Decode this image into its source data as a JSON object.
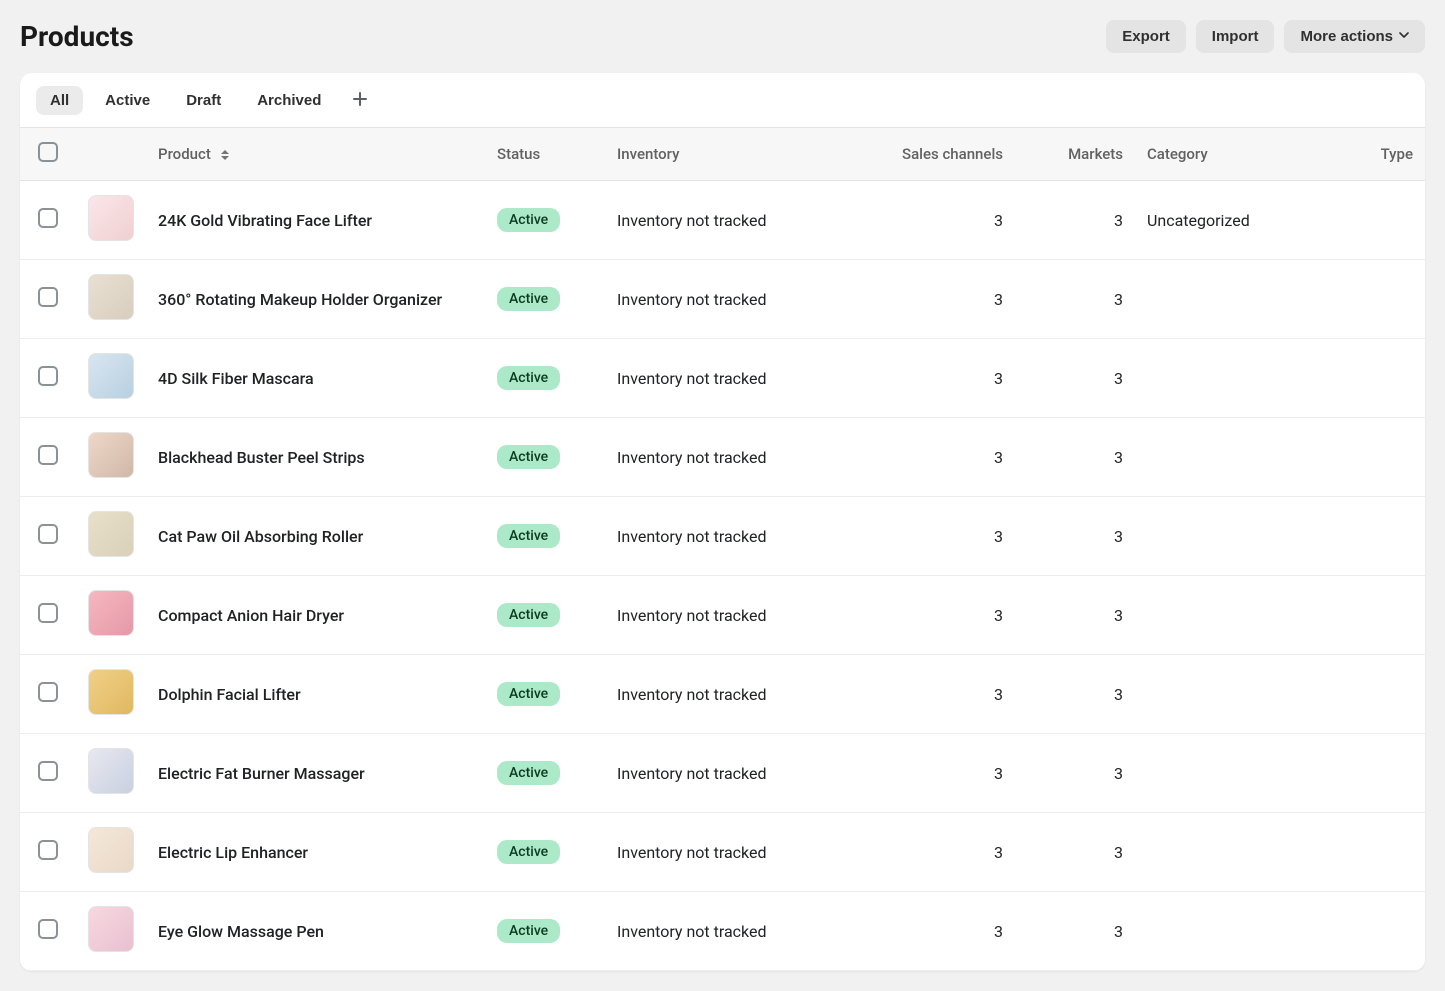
{
  "header": {
    "title": "Products",
    "export_label": "Export",
    "import_label": "Import",
    "more_label": "More actions"
  },
  "tabs": [
    "All",
    "Active",
    "Draft",
    "Archived"
  ],
  "active_tab_index": 0,
  "columns": {
    "product": "Product",
    "status": "Status",
    "inventory": "Inventory",
    "sales_channels": "Sales channels",
    "markets": "Markets",
    "category": "Category",
    "type": "Type"
  },
  "status_labels": {
    "active": "Active"
  },
  "inventory_not_tracked": "Inventory not tracked",
  "products": [
    {
      "name": "24K Gold Vibrating Face Lifter",
      "status": "active",
      "inventory": "not_tracked",
      "sales_channels": 3,
      "markets": 3,
      "category": "Uncategorized",
      "type": ""
    },
    {
      "name": "360° Rotating Makeup Holder Organizer",
      "status": "active",
      "inventory": "not_tracked",
      "sales_channels": 3,
      "markets": 3,
      "category": "",
      "type": ""
    },
    {
      "name": "4D Silk Fiber Mascara",
      "status": "active",
      "inventory": "not_tracked",
      "sales_channels": 3,
      "markets": 3,
      "category": "",
      "type": ""
    },
    {
      "name": "Blackhead Buster Peel Strips",
      "status": "active",
      "inventory": "not_tracked",
      "sales_channels": 3,
      "markets": 3,
      "category": "",
      "type": ""
    },
    {
      "name": "Cat Paw Oil Absorbing Roller",
      "status": "active",
      "inventory": "not_tracked",
      "sales_channels": 3,
      "markets": 3,
      "category": "",
      "type": ""
    },
    {
      "name": "Compact Anion Hair Dryer",
      "status": "active",
      "inventory": "not_tracked",
      "sales_channels": 3,
      "markets": 3,
      "category": "",
      "type": ""
    },
    {
      "name": "Dolphin Facial Lifter",
      "status": "active",
      "inventory": "not_tracked",
      "sales_channels": 3,
      "markets": 3,
      "category": "",
      "type": ""
    },
    {
      "name": "Electric Fat Burner Massager",
      "status": "active",
      "inventory": "not_tracked",
      "sales_channels": 3,
      "markets": 3,
      "category": "",
      "type": ""
    },
    {
      "name": "Electric Lip Enhancer",
      "status": "active",
      "inventory": "not_tracked",
      "sales_channels": 3,
      "markets": 3,
      "category": "",
      "type": ""
    },
    {
      "name": "Eye Glow Massage Pen",
      "status": "active",
      "inventory": "not_tracked",
      "sales_channels": 3,
      "markets": 3,
      "category": "",
      "type": ""
    }
  ],
  "thumb_colors": [
    "linear-gradient(135deg,#fbe6ea,#f0d0d0)",
    "linear-gradient(135deg,#e8e0d0,#d8cec0)",
    "linear-gradient(135deg,#d8e6f0,#b8d0e0)",
    "linear-gradient(135deg,#f0d8c8,#d0b8a8)",
    "linear-gradient(135deg,#e8e0c8,#d8d0b8)",
    "linear-gradient(135deg,#f5b8c0,#e598a8)",
    "linear-gradient(135deg,#f0d088,#e0b860)",
    "linear-gradient(135deg,#e8e8f0,#c8d0e0)",
    "linear-gradient(135deg,#f5e8d8,#e8d8c8)",
    "linear-gradient(135deg,#f8d8e0,#e8c0d0)"
  ]
}
